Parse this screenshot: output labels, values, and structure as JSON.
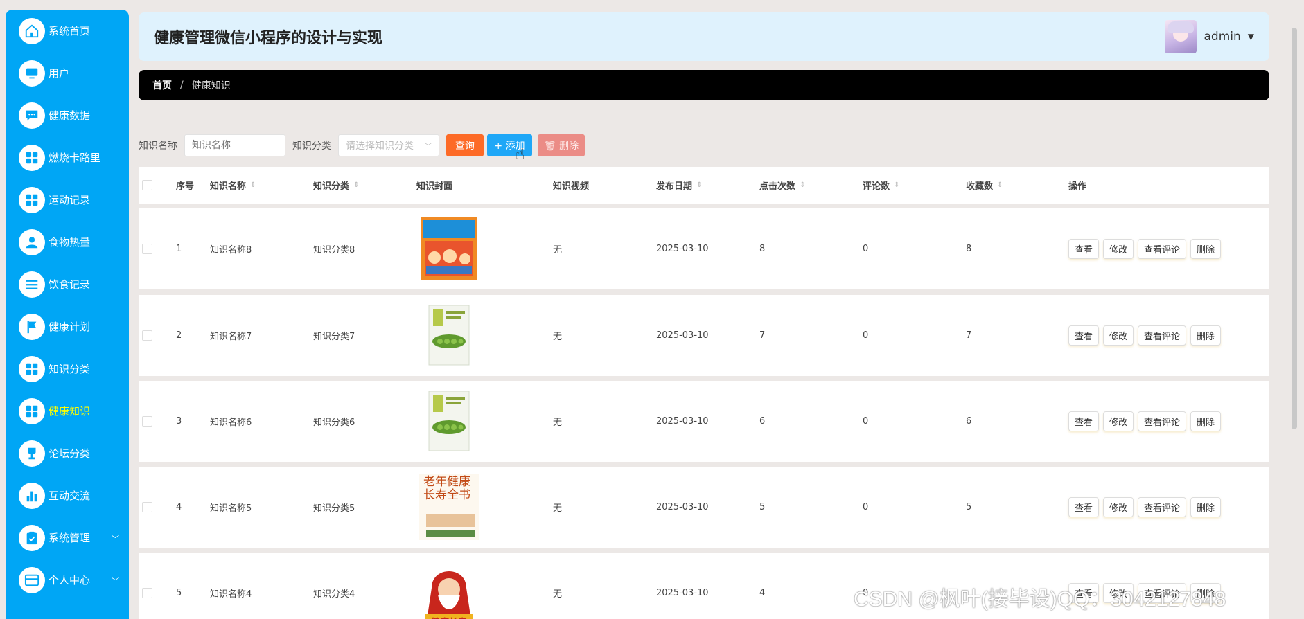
{
  "sidebar": {
    "items": [
      {
        "label": "系统首页",
        "icon": "home-icon",
        "active": false,
        "has_arrow": false
      },
      {
        "label": "用户",
        "icon": "monitor-icon",
        "active": false,
        "has_arrow": false
      },
      {
        "label": "健康数据",
        "icon": "chat-icon",
        "active": false,
        "has_arrow": false
      },
      {
        "label": "燃烧卡路里",
        "icon": "grid-icon",
        "active": false,
        "has_arrow": false
      },
      {
        "label": "运动记录",
        "icon": "grid-icon",
        "active": false,
        "has_arrow": false
      },
      {
        "label": "食物热量",
        "icon": "user-icon",
        "active": false,
        "has_arrow": false
      },
      {
        "label": "饮食记录",
        "icon": "list-icon",
        "active": false,
        "has_arrow": false
      },
      {
        "label": "健康计划",
        "icon": "flag-icon",
        "active": false,
        "has_arrow": false
      },
      {
        "label": "知识分类",
        "icon": "grid-icon",
        "active": false,
        "has_arrow": false
      },
      {
        "label": "健康知识",
        "icon": "grid-icon",
        "active": true,
        "has_arrow": false
      },
      {
        "label": "论坛分类",
        "icon": "trophy-icon",
        "active": false,
        "has_arrow": false
      },
      {
        "label": "互动交流",
        "icon": "bar-chart-icon",
        "active": false,
        "has_arrow": false
      },
      {
        "label": "系统管理",
        "icon": "clipboard-icon",
        "active": false,
        "has_arrow": true
      },
      {
        "label": "个人中心",
        "icon": "card-icon",
        "active": false,
        "has_arrow": true
      }
    ]
  },
  "header": {
    "title": "健康管理微信小程序的设计与实现",
    "username": "admin",
    "caret": "▼"
  },
  "breadcrumb": {
    "home": "首页",
    "sep": "/",
    "current": "健康知识"
  },
  "toolbar": {
    "name_label": "知识名称",
    "name_placeholder": "知识名称",
    "cat_label": "知识分类",
    "cat_placeholder": "请选择知识分类",
    "search": "查询",
    "add": "+ 添加",
    "delete": "🗑 删除"
  },
  "table": {
    "headers": {
      "idx": "序号",
      "name": "知识名称",
      "cat": "知识分类",
      "cover": "知识封面",
      "video": "知识视频",
      "date": "发布日期",
      "clicks": "点击次数",
      "comments": "评论数",
      "favs": "收藏数",
      "ops": "操作"
    },
    "op_labels": {
      "view": "查看",
      "edit": "修改",
      "comments": "查看评论",
      "delete": "删除"
    },
    "rows": [
      {
        "idx": "1",
        "name": "知识名称8",
        "cat": "知识分类8",
        "cover": "kids-book-cover",
        "video": "无",
        "date": "2025-03-10",
        "clicks": "8",
        "comments": "0",
        "favs": "8"
      },
      {
        "idx": "2",
        "name": "知识名称7",
        "cat": "知识分类7",
        "cover": "green-book-cover",
        "video": "无",
        "date": "2025-03-10",
        "clicks": "7",
        "comments": "0",
        "favs": "7"
      },
      {
        "idx": "3",
        "name": "知识名称6",
        "cat": "知识分类6",
        "cover": "green-book-cover",
        "video": "无",
        "date": "2025-03-10",
        "clicks": "6",
        "comments": "0",
        "favs": "6"
      },
      {
        "idx": "4",
        "name": "知识名称5",
        "cat": "知识分类5",
        "cover": "elderly-health-book",
        "cover_text": "老年健康长寿全书",
        "video": "无",
        "date": "2025-03-10",
        "clicks": "5",
        "comments": "0",
        "favs": "5"
      },
      {
        "idx": "5",
        "name": "知识名称4",
        "cat": "知识分类4",
        "cover": "longevity-god-cover",
        "cover_text": "健康长寿",
        "video": "无",
        "date": "2025-03-10",
        "clicks": "4",
        "comments": "0",
        "favs": ""
      }
    ]
  },
  "watermark": "CSDN @枫叶(接毕设)QQ：3042127848",
  "colors": {
    "sidebar": "#00a6f5",
    "active_label": "#ffff00",
    "header_bg": "#dff2fd",
    "search_btn": "#fd6a26",
    "add_btn": "#1fa7f7",
    "delete_btn": "#eb8c86"
  }
}
